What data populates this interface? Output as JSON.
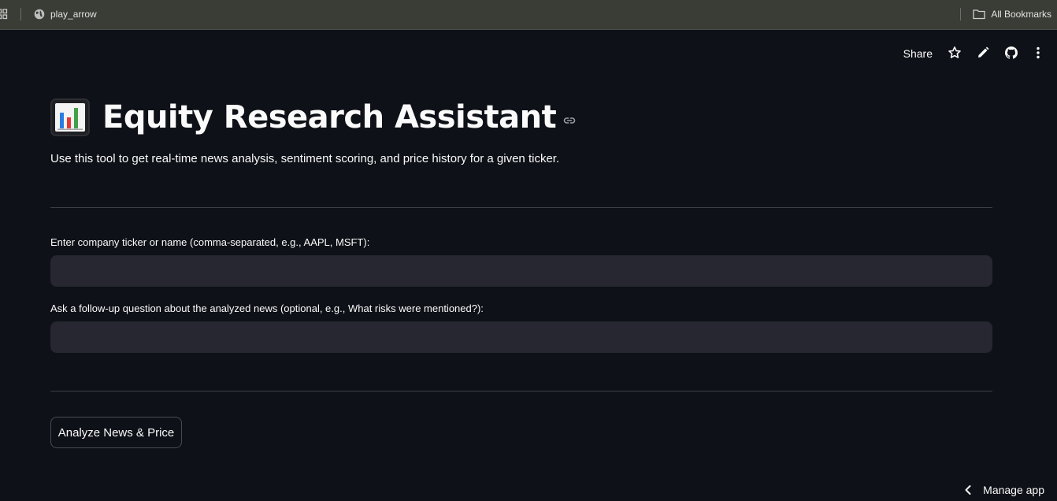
{
  "browser": {
    "bookmark_label": "play_arrow",
    "all_bookmarks_label": "All Bookmarks"
  },
  "header": {
    "share_label": "Share",
    "icons": [
      "star-icon",
      "edit-icon",
      "github-icon",
      "more-vert-icon"
    ]
  },
  "main": {
    "title": "Equity Research Assistant",
    "title_emoji": "bar-chart-icon",
    "subtitle": "Use this tool to get real-time news analysis, sentiment scoring, and price history for a given ticker.",
    "ticker_field": {
      "label": "Enter company ticker or name (comma-separated, e.g., AAPL, MSFT):",
      "value": "",
      "placeholder": ""
    },
    "question_field": {
      "label": "Ask a follow-up question about the analyzed news (optional, e.g., What risks were mentioned?):",
      "value": "",
      "placeholder": ""
    },
    "analyze_button": "Analyze News & Price"
  },
  "footer": {
    "manage_app_label": "Manage app"
  },
  "colors": {
    "background": "#0e1117",
    "input_background": "#262730",
    "bookmarks_bar": "#3a3c36",
    "text": "#fafafa"
  }
}
